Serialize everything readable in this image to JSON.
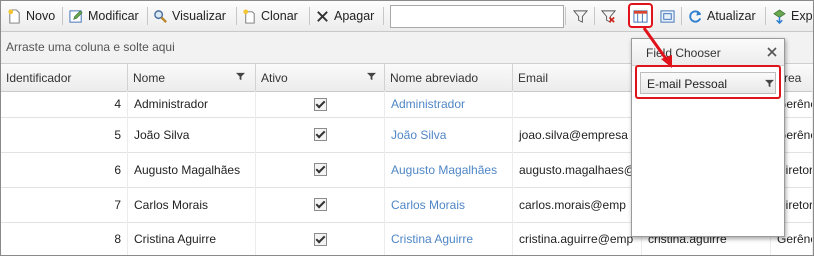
{
  "toolbar": {
    "novo": "Novo",
    "modificar": "Modificar",
    "visualizar": "Visualizar",
    "clonar": "Clonar",
    "apagar": "Apagar",
    "search_value": "",
    "atualizar": "Atualizar",
    "exportar": "Exp"
  },
  "group_panel": {
    "hint": "Arraste uma coluna e solte aqui"
  },
  "columns": {
    "id": "Identificador",
    "nome": "Nome",
    "ativo": "Ativo",
    "nome_abreviado": "Nome abreviado",
    "email": "Email",
    "area": "Área"
  },
  "rows": [
    {
      "id": "4",
      "nome": "Administrador",
      "ativo": true,
      "abrev": "Administrador",
      "email": "",
      "login": "",
      "area": "Gerênc"
    },
    {
      "id": "5",
      "nome": "João Silva",
      "ativo": true,
      "abrev": "João Silva",
      "email": "joao.silva@empresa",
      "login": "",
      "area": "Gerênc"
    },
    {
      "id": "6",
      "nome": "Augusto Magalhães",
      "ativo": true,
      "abrev": "Augusto Magalhães",
      "email": "augusto.magalhaes@",
      "login": "",
      "area": "Diretor"
    },
    {
      "id": "7",
      "nome": "Carlos Morais",
      "ativo": true,
      "abrev": "Carlos Morais",
      "email": "carlos.morais@emp",
      "login": "",
      "area": "Diretor"
    },
    {
      "id": "8",
      "nome": "Cristina Aguirre",
      "ativo": true,
      "abrev": "Cristina Aguirre",
      "email": "cristina.aguirre@emp",
      "login": "cristina.aguirre",
      "area": "Gerênc"
    }
  ],
  "field_chooser": {
    "title": "Field Chooser",
    "items": [
      "E-mail Pessoal"
    ]
  },
  "colors": {
    "accent_red": "#e0131b",
    "link": "#4f86c6"
  }
}
